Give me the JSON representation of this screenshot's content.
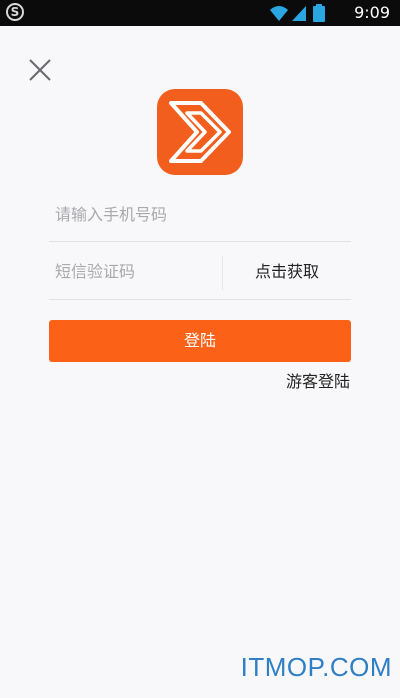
{
  "status_bar": {
    "time": "9:09",
    "left_icon_letter": "S",
    "icons": [
      "wifi-icon",
      "signal-icon",
      "battery-icon"
    ]
  },
  "header": {
    "close_icon": "close-icon"
  },
  "logo": {
    "icon": "double-chevron-logo-icon",
    "brand_color": "#f25e1d"
  },
  "form": {
    "phone_placeholder": "请输入手机号码",
    "code_placeholder": "短信验证码",
    "get_code_label": "点击获取",
    "login_label": "登陆",
    "guest_login_label": "游客登陆"
  },
  "colors": {
    "accent": "#fb6117",
    "background": "#f8f8fa",
    "watermark": "#2f7fc4"
  },
  "watermark": {
    "text": "ITMOP.COM"
  }
}
